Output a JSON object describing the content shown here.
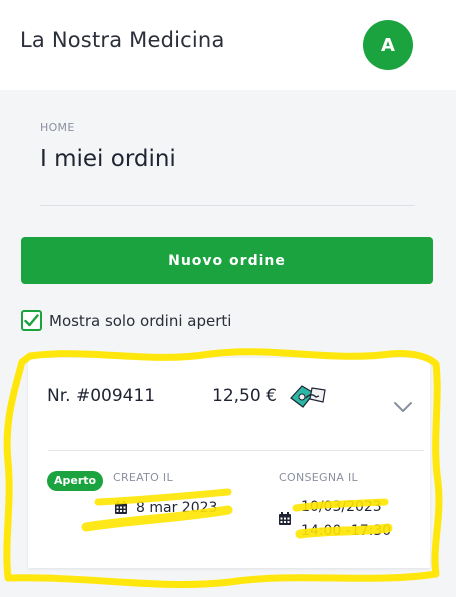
{
  "header": {
    "app_title": "La Nostra Medicina",
    "avatar_initial": "A"
  },
  "page": {
    "breadcrumb": "HOME",
    "title": "I miei ordini"
  },
  "actions": {
    "new_order_label": "Nuovo ordine"
  },
  "filter": {
    "label": "Mostra solo ordini aperti",
    "checked": true
  },
  "order": {
    "number": "Nr. #009411",
    "amount": "12,50 €",
    "payment_icon": "handshake-payment-icon",
    "status": "Aperto",
    "created_label": "CREATO IL",
    "created_date": "8 mar 2023",
    "delivery_label": "CONSEGNA IL",
    "delivery_date": "10/03/2023",
    "delivery_time": "14:00 -17:30"
  },
  "colors": {
    "accent": "#1aa33f",
    "highlight": "#ffe600"
  }
}
